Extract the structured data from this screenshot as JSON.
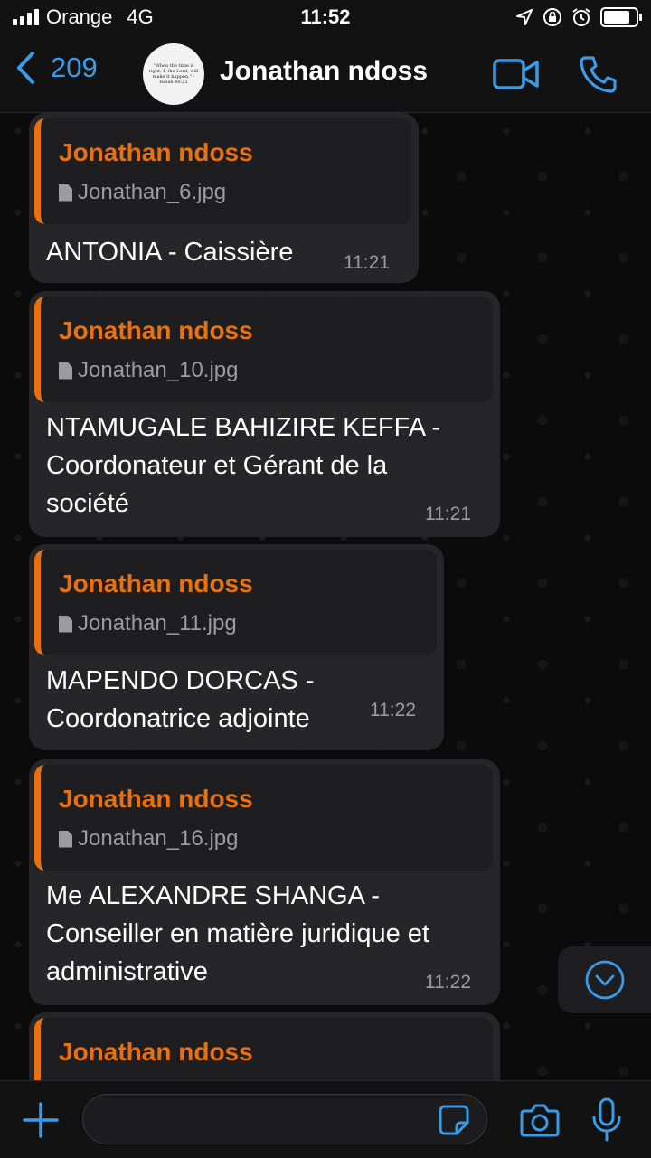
{
  "status": {
    "carrier": "Orange",
    "network": "4G",
    "time": "11:52"
  },
  "header": {
    "back_count": "209",
    "contact_name": "Jonathan ndoss",
    "avatar_text": "\"When the time is right, I, the Lord, will make it happen.\" - Isaiah 60:22"
  },
  "messages": [
    {
      "quote_name": "Jonathan ndoss",
      "quote_file": "Jonathan_6.jpg",
      "lines": [
        "ANTONIA - Caissière"
      ],
      "time": "11:21"
    },
    {
      "quote_name": "Jonathan ndoss",
      "quote_file": "Jonathan_10.jpg",
      "lines": [
        "NTAMUGALE BAHIZIRE KEFFA -",
        "Coordonateur et Gérant de la",
        "société"
      ],
      "time": "11:21"
    },
    {
      "quote_name": "Jonathan ndoss",
      "quote_file": "Jonathan_11.jpg",
      "lines": [
        "MAPENDO DORCAS -",
        "Coordonatrice adjointe"
      ],
      "time": "11:22"
    },
    {
      "quote_name": "Jonathan ndoss",
      "quote_file": "Jonathan_16.jpg",
      "lines": [
        "Me ALEXANDRE SHANGA -",
        "Conseiller en matière juridique et",
        "administrative"
      ],
      "time": "11:22"
    },
    {
      "quote_name": "Jonathan ndoss",
      "quote_file": "",
      "lines": [],
      "time": ""
    }
  ],
  "colors": {
    "accent": "#3a9be8",
    "quote_name": "#e8700e",
    "bubble": "#262628"
  },
  "icons": {
    "back": "chevron-left-icon",
    "video": "video-call-icon",
    "phone": "phone-icon",
    "attach": "plus-icon",
    "sticker": "sticker-icon",
    "camera": "camera-icon",
    "mic": "microphone-icon",
    "scroll": "chevron-down-circle-icon"
  }
}
